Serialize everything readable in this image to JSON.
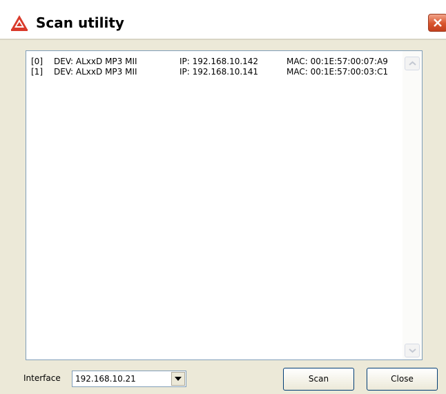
{
  "window": {
    "title": "Scan utility",
    "icon": "app-logo-icon",
    "close_icon": "close-icon"
  },
  "device_list": {
    "rows": [
      {
        "index": "[0]",
        "dev": "DEV: ALxxD MP3 MII",
        "ip": "IP: 192.168.10.142",
        "mac": "MAC: 00:1E:57:00:07:A9"
      },
      {
        "index": "[1]",
        "dev": "DEV: ALxxD MP3 MII",
        "ip": "IP: 192.168.10.141",
        "mac": "MAC: 00:1E:57:00:03:C1"
      }
    ]
  },
  "footer": {
    "interface_label": "Interface",
    "interface_value": "192.168.10.21",
    "scan_label": "Scan",
    "close_label": "Close"
  },
  "colors": {
    "dialog_bg": "#ECE9D8",
    "close_button": "#D8542D",
    "button_border": "#003C74"
  }
}
